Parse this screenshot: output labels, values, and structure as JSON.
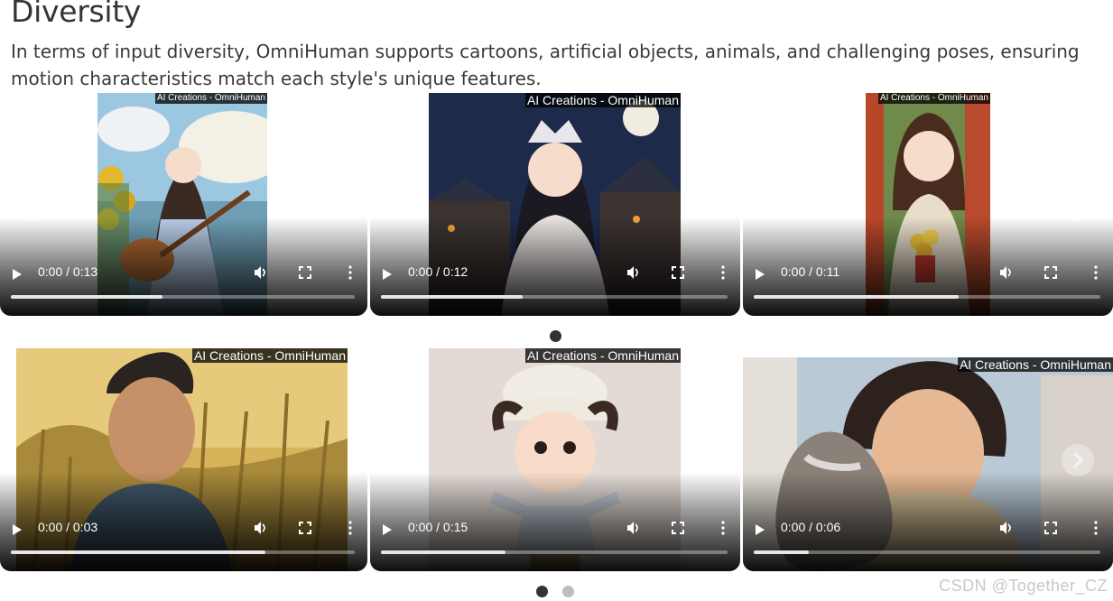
{
  "section": {
    "title": "Diversity",
    "description": "In terms of input diversity, OmniHuman supports cartoons, artificial objects, animals, and challenging poses, ensuring motion characteristics match each style's unique features."
  },
  "watermark_label": "AI Creations - OmniHuman",
  "videos": [
    {
      "time": "0:00 / 0:13",
      "progress": 0.44,
      "scene": "anime girl playing guitar by a lake"
    },
    {
      "time": "0:00 / 0:12",
      "progress": 0.41,
      "scene": "princess with crown sitting at night"
    },
    {
      "time": "0:00 / 0:11",
      "progress": 0.59,
      "scene": "girl holding flower bouquet"
    },
    {
      "time": "0:00 / 0:03",
      "progress": 0.74,
      "scene": "man in wheat field at sunset"
    },
    {
      "time": "0:00 / 0:15",
      "progress": 0.36,
      "scene": "3D toy boy in knit hat"
    },
    {
      "time": "0:00 / 0:06",
      "progress": 0.16,
      "scene": "woman hugging a cat"
    }
  ],
  "carousel": {
    "prev_icon": "chevron-left-icon",
    "next_icon": "chevron-right-icon",
    "row1_dots": 1,
    "row2_dots": 2,
    "row1_active": 0,
    "row2_active": 0
  },
  "footer_watermark": "CSDN @Together_CZ",
  "colors": {
    "title": "#343434",
    "text": "#3a3a3a",
    "dot_active": "#333333",
    "dot_inactive": "#bdbdbd"
  }
}
